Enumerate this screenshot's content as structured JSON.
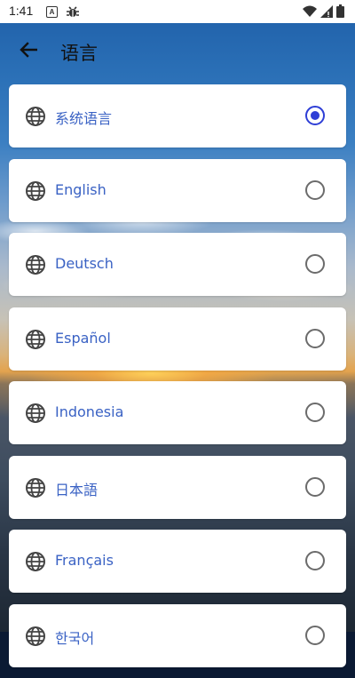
{
  "status_bar": {
    "time": "1:41",
    "icons": [
      "a-box-icon",
      "bug-icon",
      "wifi-icon",
      "signal-icon",
      "battery-icon"
    ]
  },
  "header": {
    "title": "语言",
    "back_icon": "arrow-left-icon"
  },
  "languages": [
    {
      "label": "系统语言",
      "selected": true
    },
    {
      "label": "English",
      "selected": false
    },
    {
      "label": "Deutsch",
      "selected": false
    },
    {
      "label": "Español",
      "selected": false
    },
    {
      "label": "Indonesia",
      "selected": false
    },
    {
      "label": "日本語",
      "selected": false
    },
    {
      "label": "Français",
      "selected": false
    },
    {
      "label": "한국어",
      "selected": false
    }
  ],
  "colors": {
    "label_text": "#3a62c4",
    "radio_selected": "#2f3fd6",
    "radio_unselected": "#6b6b6b",
    "card_background": "#ffffff"
  }
}
